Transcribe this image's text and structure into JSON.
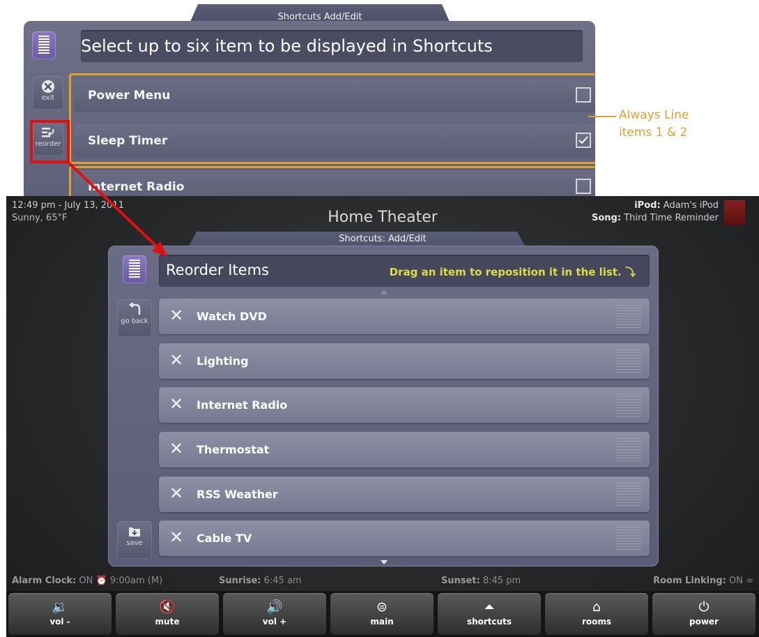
{
  "top_panel": {
    "tab_title": "Shortcuts Add/Edit",
    "header_text": "Select up to six item to be displayed in Shortcuts",
    "exit_label": "exit",
    "reorder_label": "reorder",
    "rows": [
      {
        "label": "Power Menu",
        "checked": false
      },
      {
        "label": "Sleep Timer",
        "checked": true
      },
      {
        "label": "Internet Radio",
        "checked": false
      }
    ],
    "annotation_line1": "Always Line",
    "annotation_line2": "items 1 & 2"
  },
  "topbar": {
    "time": "12:49 pm - July 13, 2011",
    "weather": "Sunny, 65°F",
    "title": "Home Theater",
    "ipod_label": "iPod:",
    "ipod_value": "Adam's iPod",
    "song_label": "Song:",
    "song_value": "Third Time Reminder"
  },
  "main_panel": {
    "tab_title": "Shortcuts: Add/Edit",
    "title": "Reorder Items",
    "hint": "Drag an item to reposition it in the list.",
    "go_back_label": "go back",
    "save_label": "save",
    "items": [
      {
        "label": "Watch DVD"
      },
      {
        "label": "Lighting"
      },
      {
        "label": "Internet Radio"
      },
      {
        "label": "Thermostat"
      },
      {
        "label": "RSS Weather"
      },
      {
        "label": "Cable TV"
      }
    ]
  },
  "statusbar": {
    "alarm_label": "Alarm Clock:",
    "alarm_value": "ON",
    "alarm_time": "9:00am (M)",
    "sunrise_label": "Sunrise:",
    "sunrise_value": "6:45 am",
    "sunset_label": "Sunset:",
    "sunset_value": "8:45 pm",
    "linking_label": "Room Linking:",
    "linking_value": "ON"
  },
  "navbar": {
    "buttons": [
      {
        "label": "vol -",
        "icon": "volume-down-icon"
      },
      {
        "label": "mute",
        "icon": "mute-icon"
      },
      {
        "label": "vol +",
        "icon": "volume-up-icon"
      },
      {
        "label": "main",
        "icon": "main-menu-icon"
      },
      {
        "label": "shortcuts",
        "icon": "shortcuts-icon"
      },
      {
        "label": "rooms",
        "icon": "home-icon"
      },
      {
        "label": "power",
        "icon": "power-icon"
      }
    ]
  },
  "colors": {
    "accent_orange": "#e0a030",
    "highlight_red": "#e01010",
    "hint_yellow": "#d8e040"
  }
}
